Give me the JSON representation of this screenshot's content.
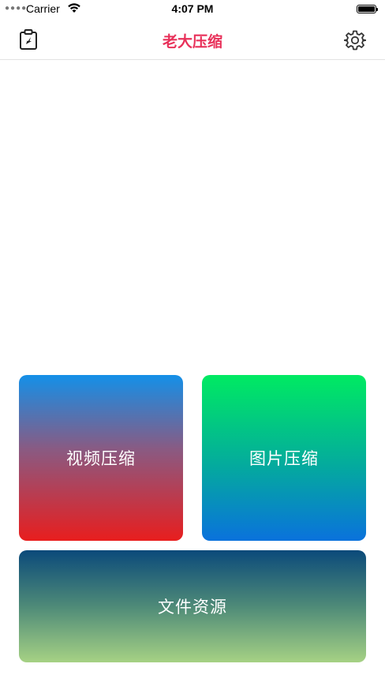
{
  "status_bar": {
    "carrier": "Carrier",
    "time": "4:07 PM"
  },
  "nav": {
    "title": "老大压缩",
    "title_color": "#e8315a",
    "left_icon": "clipboard-icon",
    "right_icon": "gear-icon"
  },
  "tiles": {
    "video": {
      "label": "视频压缩",
      "gradient": [
        "#1490e8",
        "#8a5a82",
        "#e81e1e"
      ]
    },
    "image": {
      "label": "图片压缩",
      "gradient": [
        "#00ea62",
        "#04aa9e",
        "#0a72dc"
      ]
    },
    "files": {
      "label": "文件资源",
      "gradient": [
        "#0b4a7a",
        "#4e8a78",
        "#a6d184"
      ]
    }
  }
}
